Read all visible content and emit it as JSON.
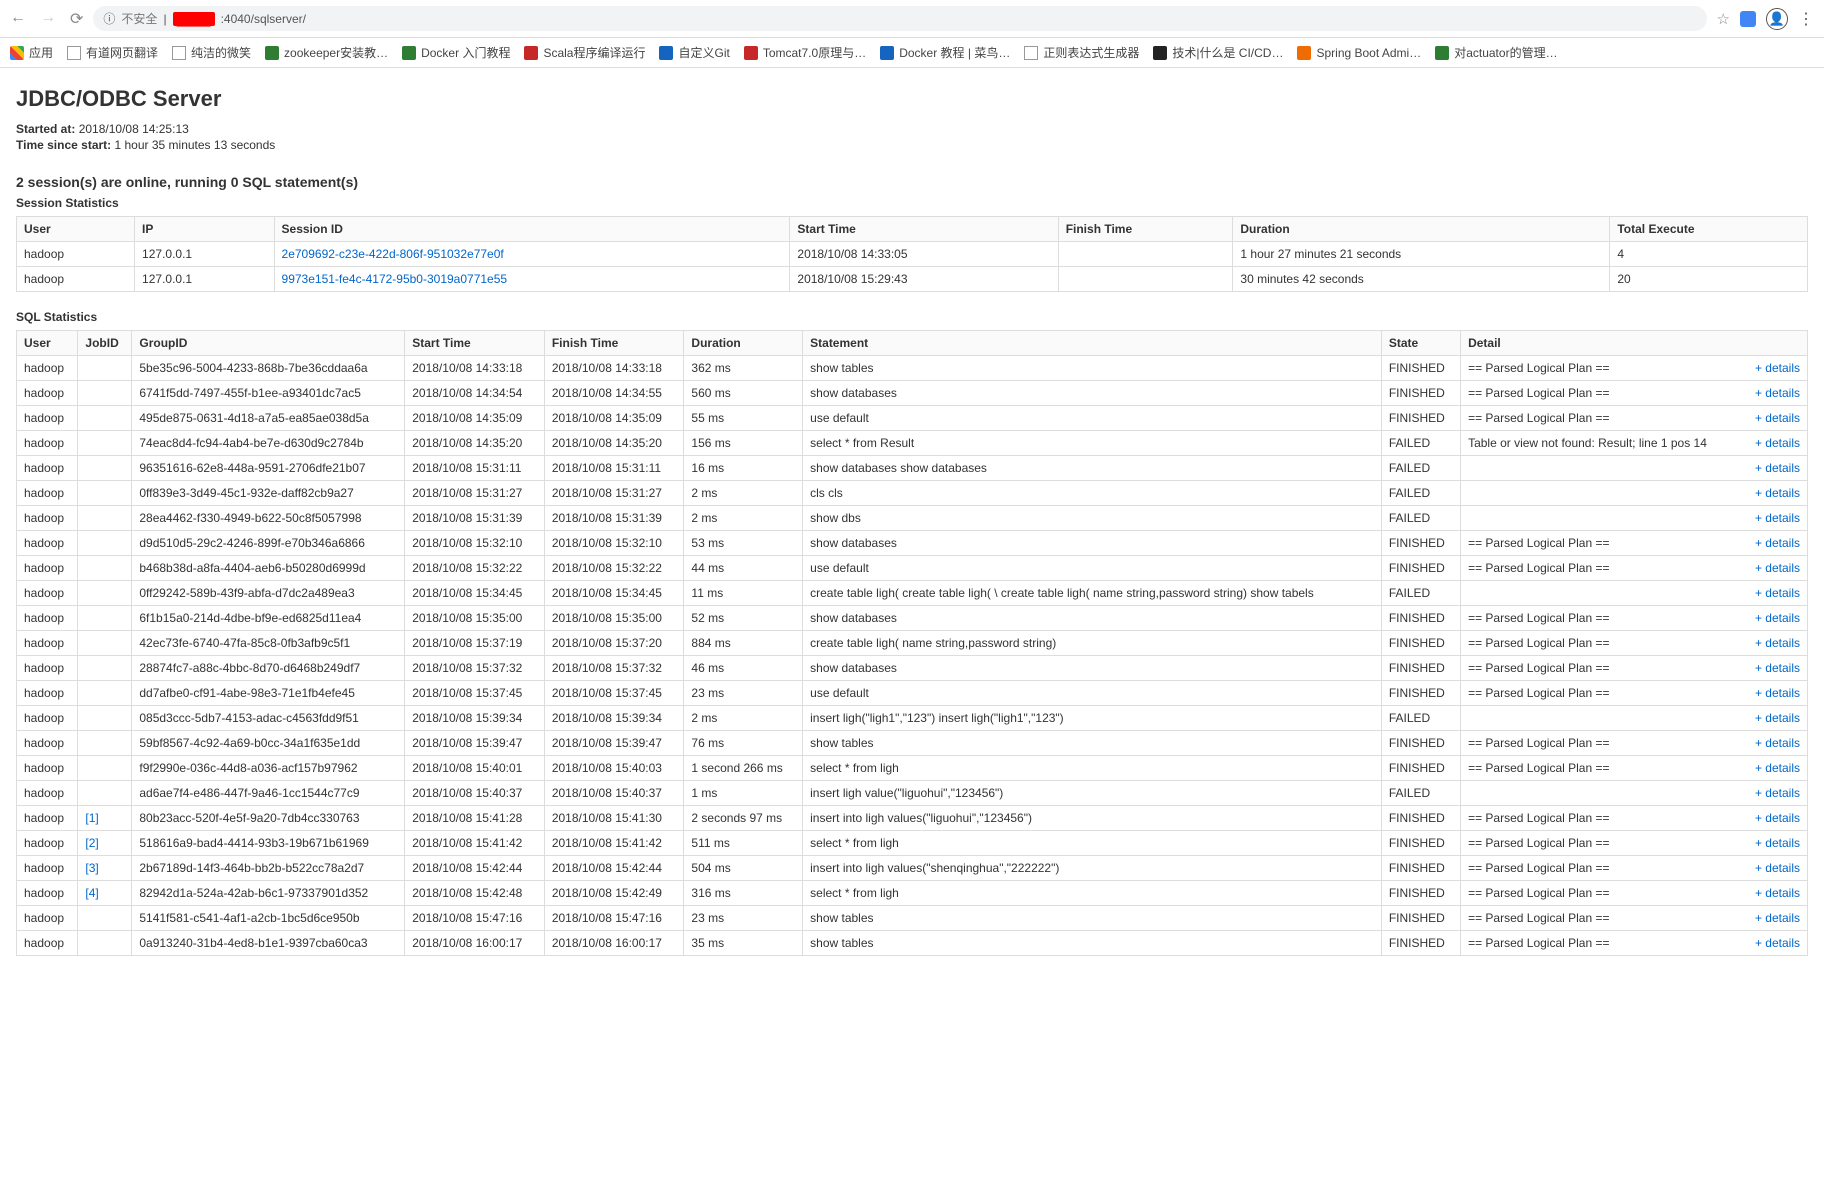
{
  "browser": {
    "url_prefix_insecure": "不安全",
    "url_redacted": "████",
    "url_rest": ":4040/sqlserver/",
    "info_icon": "ⓘ"
  },
  "bookmarks": [
    {
      "icon": "apps",
      "label": "应用"
    },
    {
      "icon": "doc",
      "label": "有道网页翻译"
    },
    {
      "icon": "doc",
      "label": "纯洁的微笑"
    },
    {
      "icon": "green",
      "label": "zookeeper安装教…"
    },
    {
      "icon": "green",
      "label": "Docker 入门教程"
    },
    {
      "icon": "red",
      "label": "Scala程序编译运行"
    },
    {
      "icon": "blue",
      "label": "自定义Git"
    },
    {
      "icon": "red",
      "label": "Tomcat7.0原理与…"
    },
    {
      "icon": "blue",
      "label": "Docker 教程 | 菜鸟…"
    },
    {
      "icon": "doc",
      "label": "正则表达式生成器"
    },
    {
      "icon": "black",
      "label": "技术|什么是 CI/CD…"
    },
    {
      "icon": "orange",
      "label": "Spring Boot Admi…"
    },
    {
      "icon": "green",
      "label": "对actuator的管理…"
    }
  ],
  "page": {
    "title": "JDBC/ODBC Server",
    "started_label": "Started at:",
    "started_value": "2018/10/08 14:25:13",
    "since_label": "Time since start:",
    "since_value": "1 hour 35 minutes 13 seconds",
    "sessions_heading": "2 session(s) are online, running 0 SQL statement(s)",
    "session_stats_label": "Session Statistics",
    "sql_stats_label": "SQL Statistics"
  },
  "session_headers": [
    "User",
    "IP",
    "Session ID",
    "Start Time",
    "Finish Time",
    "Duration",
    "Total Execute"
  ],
  "sessions": [
    {
      "user": "hadoop",
      "ip": "127.0.0.1",
      "sid": "2e709692-c23e-422d-806f-951032e77e0f",
      "start": "2018/10/08 14:33:05",
      "finish": "",
      "dur": "1 hour 27 minutes 21 seconds",
      "total": "4"
    },
    {
      "user": "hadoop",
      "ip": "127.0.0.1",
      "sid": "9973e151-fe4c-4172-95b0-3019a0771e55",
      "start": "2018/10/08 15:29:43",
      "finish": "",
      "dur": "30 minutes 42 seconds",
      "total": "20"
    }
  ],
  "sql_headers": [
    "User",
    "JobID",
    "GroupID",
    "Start Time",
    "Finish Time",
    "Duration",
    "Statement",
    "State",
    "Detail"
  ],
  "details_link_label": "+ details",
  "sql_rows": [
    {
      "user": "hadoop",
      "job": "",
      "gid": "5be35c96-5004-4233-868b-7be36cddaa6a",
      "st": "2018/10/08 14:33:18",
      "ft": "2018/10/08 14:33:18",
      "dur": "362 ms",
      "stmt": "show tables",
      "state": "FINISHED",
      "detail": "== Parsed Logical Plan =="
    },
    {
      "user": "hadoop",
      "job": "",
      "gid": "6741f5dd-7497-455f-b1ee-a93401dc7ac5",
      "st": "2018/10/08 14:34:54",
      "ft": "2018/10/08 14:34:55",
      "dur": "560 ms",
      "stmt": "show databases",
      "state": "FINISHED",
      "detail": "== Parsed Logical Plan =="
    },
    {
      "user": "hadoop",
      "job": "",
      "gid": "495de875-0631-4d18-a7a5-ea85ae038d5a",
      "st": "2018/10/08 14:35:09",
      "ft": "2018/10/08 14:35:09",
      "dur": "55 ms",
      "stmt": "use default",
      "state": "FINISHED",
      "detail": "== Parsed Logical Plan =="
    },
    {
      "user": "hadoop",
      "job": "",
      "gid": "74eac8d4-fc94-4ab4-be7e-d630d9c2784b",
      "st": "2018/10/08 14:35:20",
      "ft": "2018/10/08 14:35:20",
      "dur": "156 ms",
      "stmt": "select * from Result",
      "state": "FAILED",
      "detail": "Table or view not found: Result; line 1 pos 14"
    },
    {
      "user": "hadoop",
      "job": "",
      "gid": "96351616-62e8-448a-9591-2706dfe21b07",
      "st": "2018/10/08 15:31:11",
      "ft": "2018/10/08 15:31:11",
      "dur": "16 ms",
      "stmt": "show databases show databases",
      "state": "FAILED",
      "detail": ""
    },
    {
      "user": "hadoop",
      "job": "",
      "gid": "0ff839e3-3d49-45c1-932e-daff82cb9a27",
      "st": "2018/10/08 15:31:27",
      "ft": "2018/10/08 15:31:27",
      "dur": "2 ms",
      "stmt": "cls cls",
      "state": "FAILED",
      "detail": ""
    },
    {
      "user": "hadoop",
      "job": "",
      "gid": "28ea4462-f330-4949-b622-50c8f5057998",
      "st": "2018/10/08 15:31:39",
      "ft": "2018/10/08 15:31:39",
      "dur": "2 ms",
      "stmt": "show dbs",
      "state": "FAILED",
      "detail": ""
    },
    {
      "user": "hadoop",
      "job": "",
      "gid": "d9d510d5-29c2-4246-899f-e70b346a6866",
      "st": "2018/10/08 15:32:10",
      "ft": "2018/10/08 15:32:10",
      "dur": "53 ms",
      "stmt": "show databases",
      "state": "FINISHED",
      "detail": "== Parsed Logical Plan =="
    },
    {
      "user": "hadoop",
      "job": "",
      "gid": "b468b38d-a8fa-4404-aeb6-b50280d6999d",
      "st": "2018/10/08 15:32:22",
      "ft": "2018/10/08 15:32:22",
      "dur": "44 ms",
      "stmt": "use default",
      "state": "FINISHED",
      "detail": "== Parsed Logical Plan =="
    },
    {
      "user": "hadoop",
      "job": "",
      "gid": "0ff29242-589b-43f9-abfa-d7dc2a489ea3",
      "st": "2018/10/08 15:34:45",
      "ft": "2018/10/08 15:34:45",
      "dur": "11 ms",
      "stmt": "create table ligh( create table ligh( \\ create table ligh( name string,password string) show tabels",
      "state": "FAILED",
      "detail": ""
    },
    {
      "user": "hadoop",
      "job": "",
      "gid": "6f1b15a0-214d-4dbe-bf9e-ed6825d11ea4",
      "st": "2018/10/08 15:35:00",
      "ft": "2018/10/08 15:35:00",
      "dur": "52 ms",
      "stmt": "show databases",
      "state": "FINISHED",
      "detail": "== Parsed Logical Plan =="
    },
    {
      "user": "hadoop",
      "job": "",
      "gid": "42ec73fe-6740-47fa-85c8-0fb3afb9c5f1",
      "st": "2018/10/08 15:37:19",
      "ft": "2018/10/08 15:37:20",
      "dur": "884 ms",
      "stmt": "create table ligh( name string,password string)",
      "state": "FINISHED",
      "detail": "== Parsed Logical Plan =="
    },
    {
      "user": "hadoop",
      "job": "",
      "gid": "28874fc7-a88c-4bbc-8d70-d6468b249df7",
      "st": "2018/10/08 15:37:32",
      "ft": "2018/10/08 15:37:32",
      "dur": "46 ms",
      "stmt": "show databases",
      "state": "FINISHED",
      "detail": "== Parsed Logical Plan =="
    },
    {
      "user": "hadoop",
      "job": "",
      "gid": "dd7afbe0-cf91-4abe-98e3-71e1fb4efe45",
      "st": "2018/10/08 15:37:45",
      "ft": "2018/10/08 15:37:45",
      "dur": "23 ms",
      "stmt": "use default",
      "state": "FINISHED",
      "detail": "== Parsed Logical Plan =="
    },
    {
      "user": "hadoop",
      "job": "",
      "gid": "085d3ccc-5db7-4153-adac-c4563fdd9f51",
      "st": "2018/10/08 15:39:34",
      "ft": "2018/10/08 15:39:34",
      "dur": "2 ms",
      "stmt": "insert ligh(\"ligh1\",\"123\") insert ligh(\"ligh1\",\"123\")",
      "state": "FAILED",
      "detail": ""
    },
    {
      "user": "hadoop",
      "job": "",
      "gid": "59bf8567-4c92-4a69-b0cc-34a1f635e1dd",
      "st": "2018/10/08 15:39:47",
      "ft": "2018/10/08 15:39:47",
      "dur": "76 ms",
      "stmt": "show tables",
      "state": "FINISHED",
      "detail": "== Parsed Logical Plan =="
    },
    {
      "user": "hadoop",
      "job": "",
      "gid": "f9f2990e-036c-44d8-a036-acf157b97962",
      "st": "2018/10/08 15:40:01",
      "ft": "2018/10/08 15:40:03",
      "dur": "1 second 266 ms",
      "stmt": "select * from ligh",
      "state": "FINISHED",
      "detail": "== Parsed Logical Plan =="
    },
    {
      "user": "hadoop",
      "job": "",
      "gid": "ad6ae7f4-e486-447f-9a46-1cc1544c77c9",
      "st": "2018/10/08 15:40:37",
      "ft": "2018/10/08 15:40:37",
      "dur": "1 ms",
      "stmt": "insert ligh value(\"liguohui\",\"123456\")",
      "state": "FAILED",
      "detail": ""
    },
    {
      "user": "hadoop",
      "job": "[1]",
      "gid": "80b23acc-520f-4e5f-9a20-7db4cc330763",
      "st": "2018/10/08 15:41:28",
      "ft": "2018/10/08 15:41:30",
      "dur": "2 seconds 97 ms",
      "stmt": "insert into ligh values(\"liguohui\",\"123456\")",
      "state": "FINISHED",
      "detail": "== Parsed Logical Plan =="
    },
    {
      "user": "hadoop",
      "job": "[2]",
      "gid": "518616a9-bad4-4414-93b3-19b671b61969",
      "st": "2018/10/08 15:41:42",
      "ft": "2018/10/08 15:41:42",
      "dur": "511 ms",
      "stmt": "select * from ligh",
      "state": "FINISHED",
      "detail": "== Parsed Logical Plan =="
    },
    {
      "user": "hadoop",
      "job": "[3]",
      "gid": "2b67189d-14f3-464b-bb2b-b522cc78a2d7",
      "st": "2018/10/08 15:42:44",
      "ft": "2018/10/08 15:42:44",
      "dur": "504 ms",
      "stmt": "insert into ligh values(\"shenqinghua\",\"222222\")",
      "state": "FINISHED",
      "detail": "== Parsed Logical Plan =="
    },
    {
      "user": "hadoop",
      "job": "[4]",
      "gid": "82942d1a-524a-42ab-b6c1-97337901d352",
      "st": "2018/10/08 15:42:48",
      "ft": "2018/10/08 15:42:49",
      "dur": "316 ms",
      "stmt": "select * from ligh",
      "state": "FINISHED",
      "detail": "== Parsed Logical Plan =="
    },
    {
      "user": "hadoop",
      "job": "",
      "gid": "5141f581-c541-4af1-a2cb-1bc5d6ce950b",
      "st": "2018/10/08 15:47:16",
      "ft": "2018/10/08 15:47:16",
      "dur": "23 ms",
      "stmt": "show tables",
      "state": "FINISHED",
      "detail": "== Parsed Logical Plan =="
    },
    {
      "user": "hadoop",
      "job": "",
      "gid": "0a913240-31b4-4ed8-b1e1-9397cba60ca3",
      "st": "2018/10/08 16:00:17",
      "ft": "2018/10/08 16:00:17",
      "dur": "35 ms",
      "stmt": "show tables",
      "state": "FINISHED",
      "detail": "== Parsed Logical Plan =="
    }
  ]
}
